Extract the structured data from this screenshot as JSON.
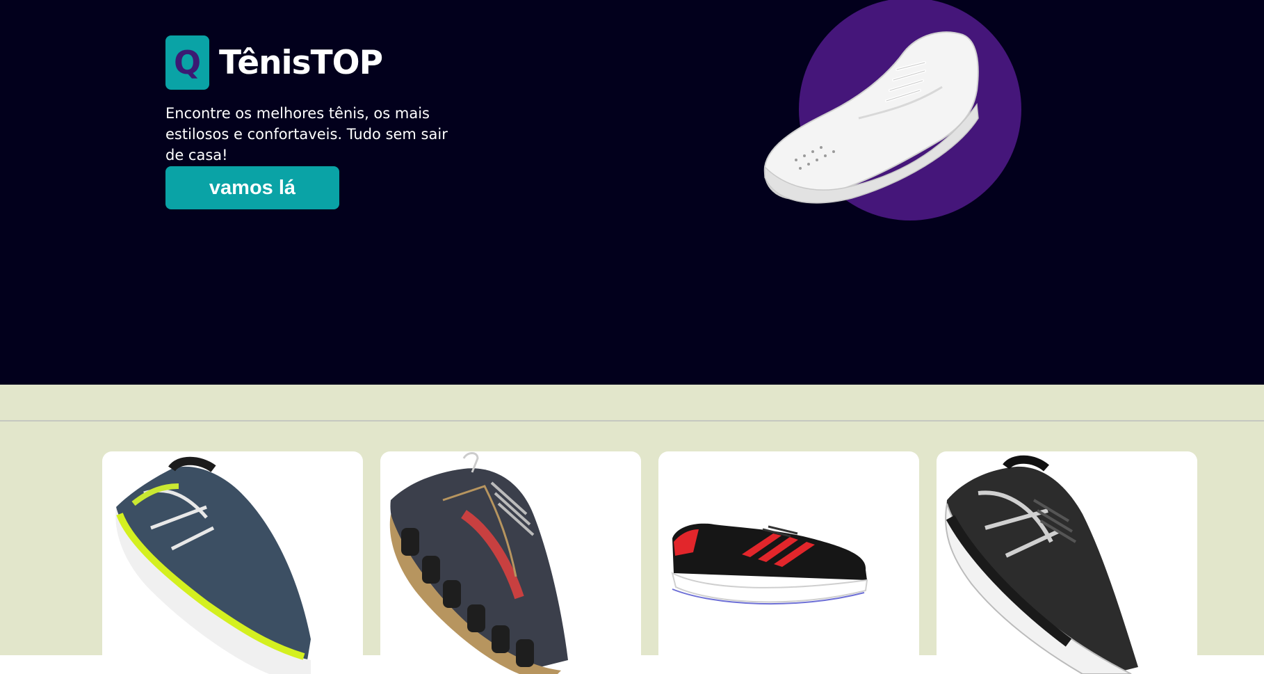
{
  "brand": {
    "logo_letter": "Q",
    "name": "TênisTOP",
    "accent_color": "#0aa3a6",
    "hero_background": "#02001c",
    "circle_color": "#45167a"
  },
  "hero": {
    "tagline": "Encontre os melhores tênis, os mais estilosos e confortaveis. Tudo sem sair de casa!",
    "cta_label": "vamos lá",
    "image_icon": "white-sneaker-image"
  },
  "products": {
    "background": "#e2e6cb",
    "items": [
      {
        "icon": "running-shoe-navy-yellow-image"
      },
      {
        "icon": "running-shoe-grey-red-image"
      },
      {
        "icon": "sneaker-black-red-stripes-image"
      },
      {
        "icon": "running-shoe-black-silver-image"
      }
    ]
  }
}
